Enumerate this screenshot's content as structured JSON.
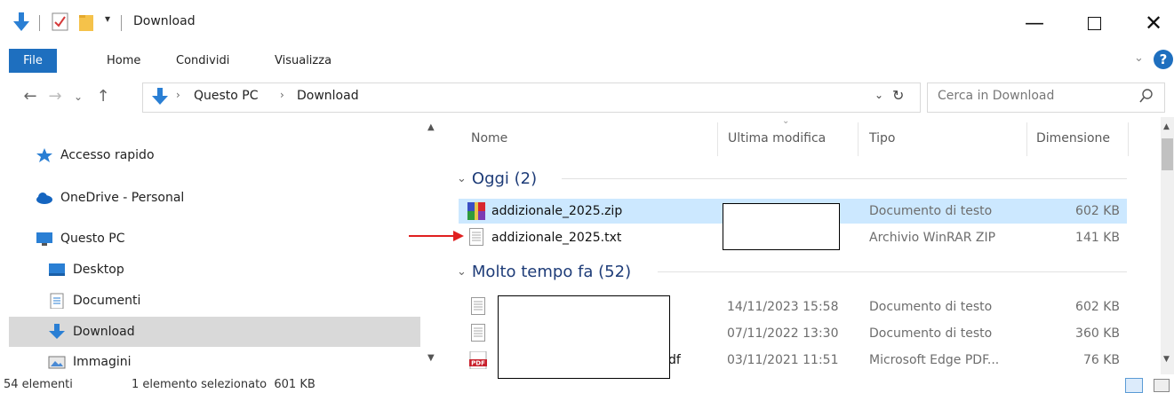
{
  "window": {
    "title": "Download"
  },
  "ribbon": {
    "tabs": [
      "File",
      "Home",
      "Condividi",
      "Visualizza"
    ]
  },
  "address": {
    "path": [
      "Questo PC",
      "Download"
    ],
    "search_placeholder": "Cerca in Download"
  },
  "nav": {
    "items": [
      {
        "label": "Accesso rapido",
        "icon": "star-icon"
      },
      {
        "label": "OneDrive - Personal",
        "icon": "cloud-icon"
      },
      {
        "label": "Questo PC",
        "icon": "monitor-icon"
      },
      {
        "label": "Desktop",
        "icon": "desktop-folder-icon"
      },
      {
        "label": "Documenti",
        "icon": "documents-folder-icon"
      },
      {
        "label": "Download",
        "icon": "download-arrow-icon",
        "selected": true
      },
      {
        "label": "Immagini",
        "icon": "pictures-folder-icon"
      }
    ]
  },
  "columns": {
    "name": "Nome",
    "modified": "Ultima modifica",
    "type": "Tipo",
    "size": "Dimensione"
  },
  "groups": {
    "today": "Oggi (2)",
    "older": "Molto tempo fa (52)"
  },
  "files_today": [
    {
      "name": "addizionale_2025.zip",
      "type": "Documento di testo",
      "size": "602 KB",
      "icon": "winrar-archive-icon",
      "selected": true
    },
    {
      "name": "addizionale_2025.txt",
      "type": "Archivio WinRAR ZIP",
      "size": "141 KB",
      "icon": "text-file-icon"
    }
  ],
  "files_older": [
    {
      "modified": "14/11/2023 15:58",
      "type": "Documento di testo",
      "size": "602 KB",
      "icon": "text-file-icon",
      "name_suffix": ""
    },
    {
      "modified": "07/11/2022 13:30",
      "type": "Documento di testo",
      "size": "360 KB",
      "icon": "text-file-icon",
      "name_suffix": ""
    },
    {
      "modified": "03/11/2021 11:51",
      "type": "Microsoft Edge PDF...",
      "size": "76 KB",
      "icon": "pdf-file-icon",
      "name_suffix": "df"
    }
  ],
  "status": {
    "count": "54 elementi",
    "selection": "1 elemento selezionato  601 KB"
  },
  "colors": {
    "accent": "#1e6fbf",
    "selection": "#cce8ff",
    "group_header": "#1e3c78",
    "annotation_arrow": "#e02020"
  }
}
